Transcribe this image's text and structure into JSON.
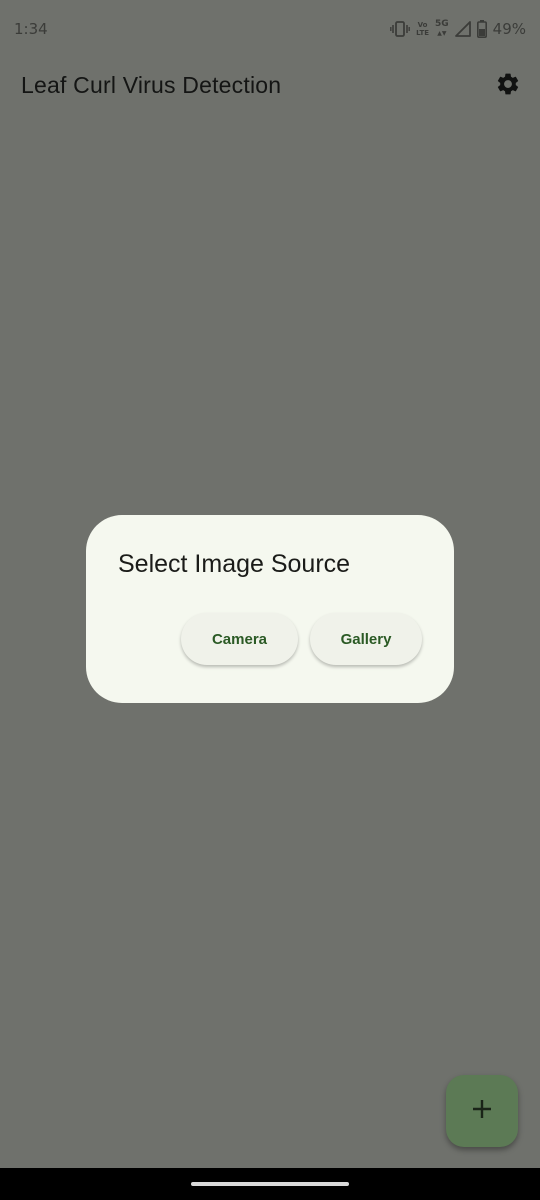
{
  "status_bar": {
    "time": "1:34",
    "volte_label_top": "Vo",
    "volte_label_bottom": "LTE",
    "network_label": "5G",
    "battery_percent": "49%",
    "icons": [
      "vibrate-icon",
      "volte-icon",
      "5g-icon",
      "signal-icon",
      "battery-icon"
    ]
  },
  "app_bar": {
    "title": "Leaf Curl Virus Detection",
    "settings_icon": "gear-icon"
  },
  "dialog": {
    "title": "Select Image Source",
    "buttons": {
      "camera": "Camera",
      "gallery": "Gallery"
    }
  },
  "fab": {
    "icon": "plus-icon"
  },
  "colors": {
    "scrim_background": "#6f716c",
    "dialog_background": "#f5f8ef",
    "button_text": "#2b5a25",
    "fab_background": "#5c7a55"
  }
}
